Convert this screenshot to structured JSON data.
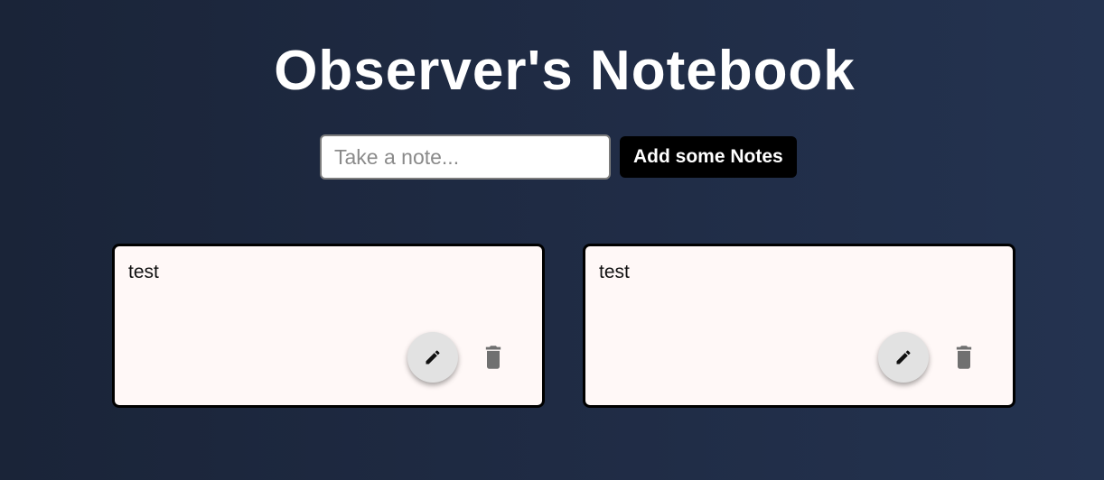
{
  "header": {
    "title": "Observer's Notebook"
  },
  "composer": {
    "placeholder": "Take a note...",
    "value": "",
    "add_label": "Add some Notes"
  },
  "notes": [
    {
      "text": "test",
      "edit_icon": "pencil-icon",
      "delete_icon": "trash-icon"
    },
    {
      "text": "test",
      "edit_icon": "pencil-icon",
      "delete_icon": "trash-icon"
    }
  ],
  "colors": {
    "background": "#1f2b44",
    "card": "#fff8f7",
    "button": "#000000",
    "icon": "#707070"
  }
}
